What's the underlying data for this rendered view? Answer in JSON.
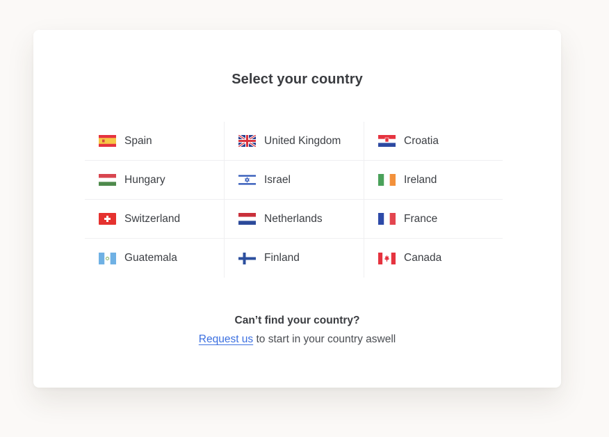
{
  "page": {
    "title": "Select your country"
  },
  "countries": [
    {
      "name": "Spain",
      "flag": "spain-flag-icon"
    },
    {
      "name": "United Kingdom",
      "flag": "united-kingdom-flag-icon"
    },
    {
      "name": "Croatia",
      "flag": "croatia-flag-icon"
    },
    {
      "name": "Hungary",
      "flag": "hungary-flag-icon"
    },
    {
      "name": "Israel",
      "flag": "israel-flag-icon"
    },
    {
      "name": "Ireland",
      "flag": "ireland-flag-icon"
    },
    {
      "name": "Switzerland",
      "flag": "switzerland-flag-icon"
    },
    {
      "name": "Netherlands",
      "flag": "netherlands-flag-icon"
    },
    {
      "name": "France",
      "flag": "france-flag-icon"
    },
    {
      "name": "Guatemala",
      "flag": "guatemala-flag-icon"
    },
    {
      "name": "Finland",
      "flag": "finland-flag-icon"
    },
    {
      "name": "Canada",
      "flag": "canada-flag-icon"
    }
  ],
  "footer": {
    "question": "Can’t find your country?",
    "link_label": "Request us",
    "suffix": " to start in your country aswell"
  },
  "colors": {
    "link": "#3b6fe0",
    "divider": "#efeff1",
    "background": "#fbf9f7"
  }
}
